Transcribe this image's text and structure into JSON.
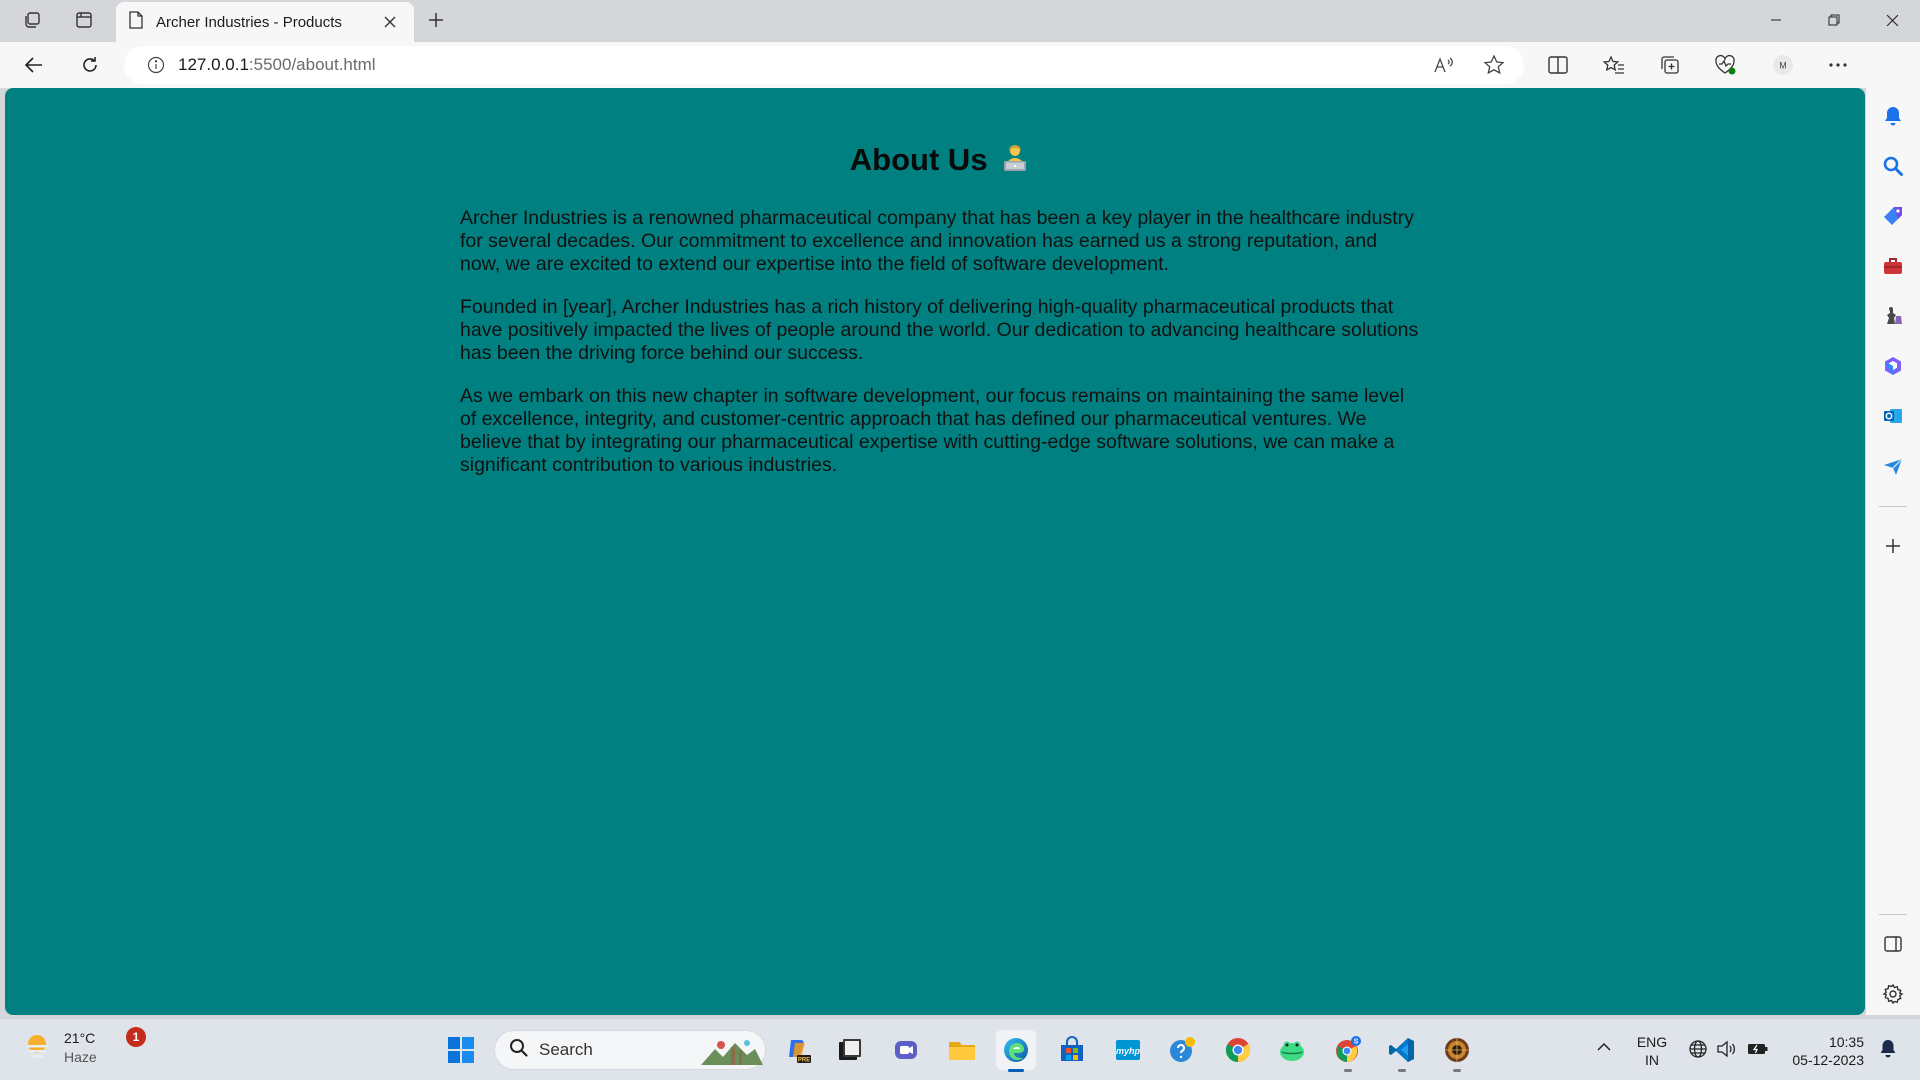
{
  "browser": {
    "tab_title": "Archer Industries - Products",
    "address_host": "127.0.0.1",
    "address_path": ":5500/about.html"
  },
  "page": {
    "background": "#008080",
    "heading": "About Us",
    "heading_emoji": "technologist-emoji",
    "paragraphs": [
      "Archer Industries is a renowned pharmaceutical company that has been a key player in the healthcare industry for several decades. Our commitment to excellence and innovation has earned us a strong reputation, and now, we are excited to extend our expertise into the field of software development.",
      "Founded in [year], Archer Industries has a rich history of delivering high-quality pharmaceutical products that have positively impacted the lives of people around the world. Our dedication to advancing healthcare solutions has been the driving force behind our success.",
      "As we embark on this new chapter in software development, our focus remains on maintaining the same level of excellence, integrity, and customer-centric approach that has defined our pharmaceutical ventures. We believe that by integrating our pharmaceutical expertise with cutting-edge software solutions, we can make a significant contribution to various industries."
    ]
  },
  "taskbar": {
    "weather_temp": "21°C",
    "weather_desc": "Haze",
    "notification_count": "1",
    "search_label": "Search",
    "lang_top": "ENG",
    "lang_bottom": "IN",
    "time": "10:35",
    "date": "05-12-2023"
  },
  "colors": {
    "accent": "#005fb8",
    "badge": "#c42b1c"
  }
}
